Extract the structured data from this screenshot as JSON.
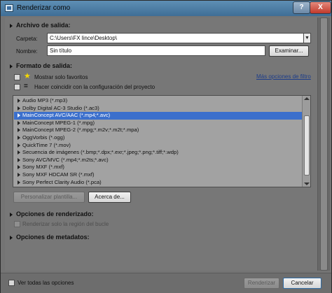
{
  "window": {
    "title": "Renderizar como",
    "help_glyph": "?",
    "close_glyph": "X"
  },
  "output_file": {
    "heading": "Archivo de salida:",
    "folder_label": "Carpeta:",
    "folder_value": "C:\\Users\\FX lince\\Desktop\\",
    "name_label": "Nombre:",
    "name_value": "Sin título",
    "browse_button": "Examinar..."
  },
  "output_format": {
    "heading": "Formato de salida:",
    "favorites_only": "Mostrar solo favoritos",
    "match_project": "Hacer coincidir con la configuración del proyecto",
    "more_filter_options": "Más opciones de filtro",
    "formats": [
      "Audio MP3 (*.mp3)",
      "Dolby Digital AC-3 Studio (*.ac3)",
      "MainConcept AVC/AAC (*.mp4;*.avc)",
      "MainConcept MPEG-1 (*.mpg)",
      "MainConcept MPEG-2 (*.mpg;*.m2v;*.m2t;*.mpa)",
      "OggVorbis (*.ogg)",
      "QuickTime 7 (*.mov)",
      "Secuencia de imágenes (*.bmp;*.dpx;*.exr;*.jpeg;*.png;*.tiff;*.wdp)",
      "Sony AVC/MVC (*.mp4;*.m2ts;*.avc)",
      "Sony MXF (*.mxf)",
      "Sony MXF HDCAM SR (*.mxf)",
      "Sony Perfect Clarity Audio (*.pca)"
    ],
    "selected_format": "MainConcept AVC/AAC (*.mp4;*.avc)",
    "customize_template": "Personalizar plantilla...",
    "about": "Acerca de..."
  },
  "render_options": {
    "heading": "Opciones de renderizado:",
    "loop_region_only": "Renderizar solo la región del bucle"
  },
  "metadata_options": {
    "heading": "Opciones de metadatos:"
  },
  "footer": {
    "show_all_options": "Ver todas las opciones",
    "render_button": "Renderizar",
    "cancel_button": "Cancelar"
  },
  "icons": {
    "app": "render-app-icon",
    "favorites": "star-icon",
    "match": "equal-icon",
    "expand": "triangle-right-icon",
    "dropdown": "chevron-down-icon"
  },
  "colors": {
    "titlebar": "#4f7fa6",
    "close_button": "#c1392b",
    "selection": "#3b6fcc",
    "link": "#1d3d8a",
    "favorite_star": "#f5d800"
  }
}
